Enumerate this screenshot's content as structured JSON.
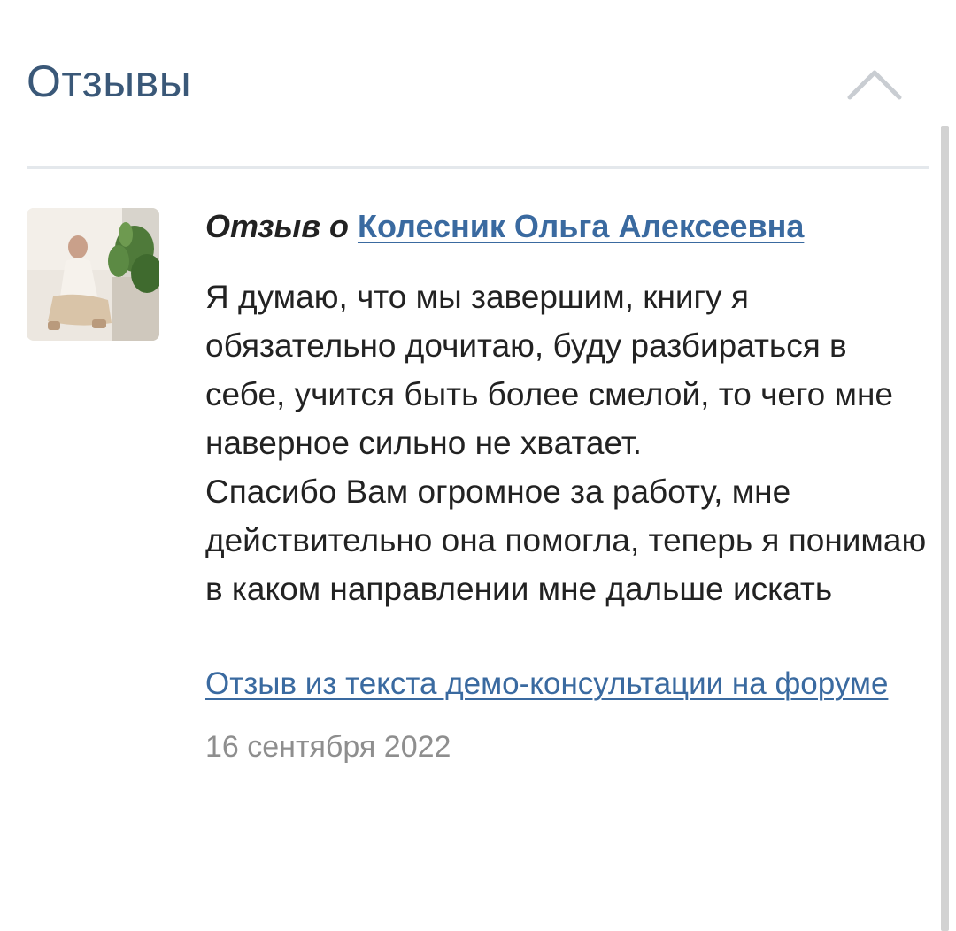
{
  "section": {
    "title": "Отзывы",
    "toggle_icon": "chevron-up-icon"
  },
  "review": {
    "heading_prefix": "Отзыв о",
    "author": "Колесник Ольга Алексеевна",
    "avatar_icon": "author-photo",
    "text_paragraphs": [
      "Я думаю, что мы завершим, книгу я обязательно дочитаю, буду разбираться в себе, учится быть более смелой, то чего мне наверное сильно не хватает.",
      "Спасибо Вам огромное за работу, мне действительно она помогла, теперь я понимаю в каком направлении мне дальше искать"
    ],
    "source_link": "Отзыв из текста демо-консультации на форуме",
    "date": "16 сентября 2022"
  },
  "colors": {
    "title": "#3a5878",
    "link": "#3a6aa0",
    "text": "#222222",
    "date": "#8e8e8e",
    "divider": "#e4e8ec"
  }
}
